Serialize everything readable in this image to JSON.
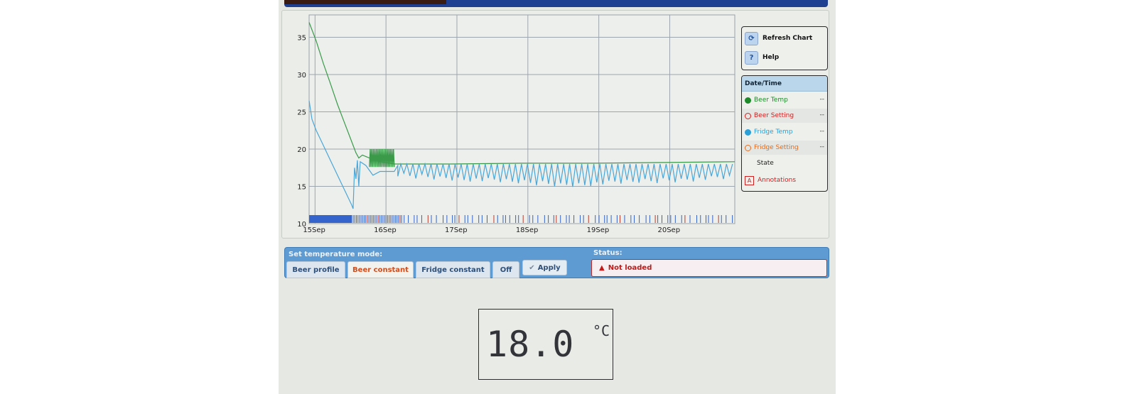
{
  "controls": {
    "refresh_label": "Refresh Chart",
    "help_label": "Help"
  },
  "legend": {
    "header": "Date/Time",
    "items": [
      {
        "label": "Beer Temp",
        "value": "--",
        "color": "#1e8a2a",
        "style": "filled"
      },
      {
        "label": "Beer Setting",
        "value": "--",
        "color": "#d32020",
        "style": "hollow"
      },
      {
        "label": "Fridge Temp",
        "value": "--",
        "color": "#2aa0d8",
        "style": "filled"
      },
      {
        "label": "Fridge Setting",
        "value": "--",
        "color": "#e86a1a",
        "style": "hollow"
      },
      {
        "label": "State",
        "value": "",
        "color": "#222222",
        "style": "none"
      },
      {
        "label": "Annotations",
        "value": "",
        "color": "#cc2222",
        "style": "annotation",
        "icon_text": "A"
      }
    ]
  },
  "chart_data": {
    "type": "line",
    "x_unit": "date",
    "x_ticks": [
      "15Sep",
      "16Sep",
      "17Sep",
      "18Sep",
      "19Sep",
      "20Sep"
    ],
    "y_ticks": [
      10,
      15,
      20,
      25,
      30,
      35
    ],
    "ylim": [
      10,
      38
    ],
    "xlim": [
      "2023-09-14T22:00",
      "2023-09-20T22:00"
    ],
    "grid": true,
    "series": [
      {
        "name": "Beer Temp",
        "color": "#3a9a4a",
        "points": [
          [
            0.0,
            37.0
          ],
          [
            0.1,
            34.5
          ],
          [
            0.2,
            31.5
          ],
          [
            0.3,
            28.8
          ],
          [
            0.4,
            26.0
          ],
          [
            0.5,
            23.5
          ],
          [
            0.6,
            21.0
          ],
          [
            0.66,
            19.5
          ],
          [
            0.7,
            18.8
          ],
          [
            0.75,
            19.2
          ],
          [
            0.85,
            18.8
          ],
          [
            1.0,
            18.3
          ],
          [
            1.2,
            18.0
          ],
          [
            1.4,
            18.0
          ],
          [
            2.0,
            18.0
          ],
          [
            3.0,
            18.1
          ],
          [
            4.0,
            18.1
          ],
          [
            5.0,
            18.2
          ],
          [
            6.0,
            18.3
          ]
        ],
        "band": {
          "from": 0.85,
          "to": 1.2,
          "low": 17.6,
          "high": 20.0,
          "oscillations": 16
        }
      },
      {
        "name": "Fridge Temp",
        "color": "#4aa6d8",
        "points": [
          [
            0.0,
            26.5
          ],
          [
            0.04,
            24.0
          ],
          [
            0.1,
            22.5
          ],
          [
            0.2,
            20.5
          ],
          [
            0.3,
            18.5
          ],
          [
            0.4,
            16.5
          ],
          [
            0.5,
            14.5
          ],
          [
            0.6,
            12.5
          ],
          [
            0.62,
            12.0
          ],
          [
            0.64,
            17.5
          ],
          [
            0.66,
            16.0
          ],
          [
            0.68,
            18.5
          ],
          [
            0.7,
            15.0
          ],
          [
            0.72,
            18.3
          ],
          [
            0.8,
            17.8
          ],
          [
            0.9,
            16.5
          ],
          [
            1.0,
            17.0
          ],
          [
            1.2,
            17.0
          ],
          [
            1.25,
            17.8
          ]
        ],
        "oscillation": {
          "from": 1.25,
          "to": 6.0,
          "high": 18.0,
          "low_start": 16.5,
          "low_mid": 15.2,
          "low_end": 16.2,
          "period": 0.085
        }
      }
    ],
    "state_marks": {
      "solid_block": [
        0.0,
        0.6
      ],
      "tick_start": 0.6,
      "tick_end": 6.0,
      "color": "#3464cc"
    }
  },
  "mode": {
    "title": "Set temperature mode:",
    "buttons": [
      "Beer profile",
      "Beer constant",
      "Fridge constant",
      "Off"
    ],
    "active": "Beer constant",
    "apply_label": "Apply",
    "apply_icon": "check-icon"
  },
  "status": {
    "title": "Status:",
    "text": "Not loaded",
    "icon": "warning-icon"
  },
  "display": {
    "value": "18.0",
    "unit": "°C"
  }
}
